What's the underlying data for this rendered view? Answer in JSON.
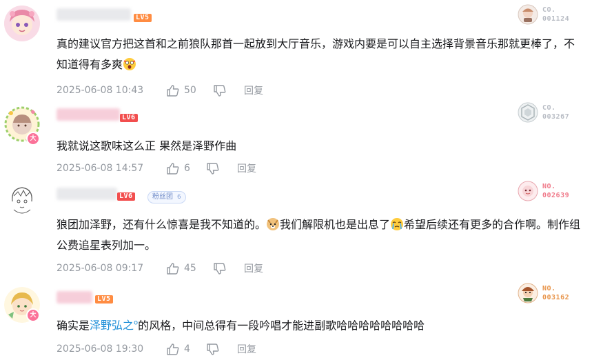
{
  "comments": [
    {
      "level": "LV5",
      "card": {
        "line1": "CO.",
        "line2": "001124"
      },
      "content": "真的建议官方把这首和之前狼队那首一起放到大厅音乐，游戏内要是可以自主选择背景音乐那就更棒了，不知道得有多爽",
      "time": "2025-06-08 10:43",
      "likes": "50",
      "reply": "回复"
    },
    {
      "level": "LV6",
      "avatar_badge": "大",
      "card": {
        "line1": "CO.",
        "line2": "003267"
      },
      "content": "我就说这歌味这么正 果然是泽野作曲",
      "time": "2025-06-08 14:57",
      "likes": "6",
      "reply": "回复"
    },
    {
      "level": "LV6",
      "fan_badge": {
        "label": "粉丝团",
        "num": "6"
      },
      "card": {
        "line1": "NO.",
        "line2": "002639"
      },
      "content_parts": [
        "狼团加泽野，还有什么惊喜是我不知道的。",
        "我们解限机也是出息了",
        "希望后续还有更多的合作啊。制作组公费追星表列加一。"
      ],
      "time": "2025-06-08 09:17",
      "likes": "45",
      "reply": "回复"
    },
    {
      "level": "LV5",
      "avatar_badge": "大",
      "card": {
        "line1": "NO.",
        "line2": "003162"
      },
      "content_pre": "确实是",
      "content_link": "泽野弘之",
      "content_post": "的风格，中间总得有一段吟唱才能进副歌哈哈哈哈哈哈哈哈",
      "time": "2025-06-08 19:30",
      "likes": "4",
      "reply": "回复"
    }
  ]
}
